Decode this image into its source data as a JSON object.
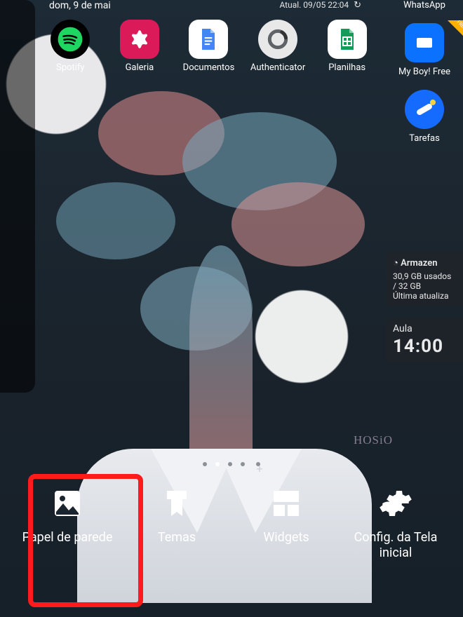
{
  "status": {
    "date": "dom, 9 de mai",
    "update_label": "Atual. 09/05 22:04"
  },
  "apps": [
    {
      "name": "spotify",
      "label": "Spotify"
    },
    {
      "name": "gallery",
      "label": "Galeria"
    },
    {
      "name": "docs",
      "label": "Documen­tos"
    },
    {
      "name": "auth",
      "label": "Authentica­tor"
    },
    {
      "name": "sheets",
      "label": "Planilhas"
    }
  ],
  "right": {
    "whatsapp_label": "WhatsApp",
    "myboy_label": "My Boy! Free",
    "tasks_label": "Tarefas",
    "storage": {
      "title": "Armazen",
      "line1": "30,9 GB usados / 32 GB",
      "line2": "Última atualiza"
    },
    "aula": {
      "title": "Aula",
      "time": "14:00"
    }
  },
  "signature": "HOSiO",
  "editbar": {
    "wallpaper": "Papel de parede",
    "themes": "Temas",
    "widgets": "Widgets",
    "settings": "Config. da Tela inicial"
  }
}
